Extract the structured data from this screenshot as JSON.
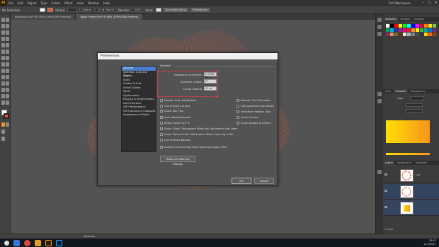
{
  "app": {
    "logo": "Ai",
    "menu": [
      "File",
      "Edit",
      "Object",
      "Type",
      "Select",
      "Effect",
      "View",
      "Window",
      "Help"
    ],
    "workspace": "Tinh Workspace",
    "window_controls": [
      "–",
      "□",
      "✕"
    ]
  },
  "controlbar": {
    "selection_label": "No Selection",
    "stroke_label": "Stroke:",
    "stroke_style": "Uniform",
    "brush": "10 pt. Round",
    "opacity_label": "Opacity:",
    "opacity_value": "100%",
    "style_label": "Style:",
    "doc_setup": "Document Setup",
    "preferences": "Preferences"
  },
  "tabs": [
    {
      "label": "background.ai* @ 150% (CMYK/GPU Preview)",
      "active": false
    },
    {
      "label": "Apple ProjectX.ai* @ 98% (CMYK/GPU Preview)",
      "active": true
    }
  ],
  "panels": {
    "swatches_tabs": [
      "Swatches",
      "Brushes",
      "Symbols"
    ],
    "gradient_tabs": [
      "Color",
      "Gradient",
      "Transparency"
    ],
    "gradient_type_label": "Type:",
    "layers_tabs": [
      "Layers",
      "Appearance",
      "Artboards"
    ],
    "layers_count": "1 Layer",
    "layers": [
      {
        "name": "Lay"
      },
      {
        "name": ""
      },
      {
        "name": ""
      }
    ]
  },
  "statusbar": {
    "tool": "Selection"
  },
  "taskbar": {
    "time": "23:47",
    "date": "11/1/2017"
  },
  "dialog": {
    "title": "Preferences",
    "nav": [
      "General",
      "Selection & Anchor Display",
      "Type",
      "Units",
      "Guides & Grid",
      "Smart Guides",
      "Slices",
      "Hyphenation",
      "Plug-ins & Scratch Disks",
      "User Interface",
      "GPU Performance",
      "File Handling & Clipboard",
      "Appearance of Black"
    ],
    "active_nav": 0,
    "section": "General",
    "fields": [
      {
        "label": "Keyboard Increment:",
        "value": "0.3528 pt"
      },
      {
        "label": "Constrain Angle:",
        "value": "0°"
      },
      {
        "label": "Corner Radius:",
        "value": "12 pt"
      }
    ],
    "left_checks": [
      {
        "label": "Disable Auto Add/Delete",
        "checked": false
      },
      {
        "label": "Use Precise Cursors",
        "checked": false
      },
      {
        "label": "Show Tool Tips",
        "checked": true
      },
      {
        "label": "Anti-aliased Artwork",
        "checked": true
      },
      {
        "label": "Select Same Tint %",
        "checked": false
      },
      {
        "label": "Show \"Start\" Workspace When No Documents Are Open",
        "checked": true
      },
      {
        "label": "Show \"Recent Files\" Workspace When Opening A File",
        "checked": false
      },
      {
        "label": "Use Preview Bounds",
        "checked": false
      },
      {
        "label": "Append [Converted] Upon Opening Legacy Files",
        "checked": true
      }
    ],
    "right_checks": [
      {
        "label": "Double Click To Isolate",
        "checked": true
      },
      {
        "label": "Use Japanese Crop Marks",
        "checked": false
      },
      {
        "label": "Transform Pattern Tiles",
        "checked": true
      },
      {
        "label": "Scale Corners",
        "checked": false
      },
      {
        "label": "Scale Strokes & Effects",
        "checked": true
      }
    ],
    "reset_button": "Reset All Warning Dialogs",
    "ok_button": "OK",
    "cancel_button": "Cancel"
  },
  "colors": {
    "accent": "#f7941e",
    "highlight": "#ff3344",
    "art": "#e05a3a"
  }
}
